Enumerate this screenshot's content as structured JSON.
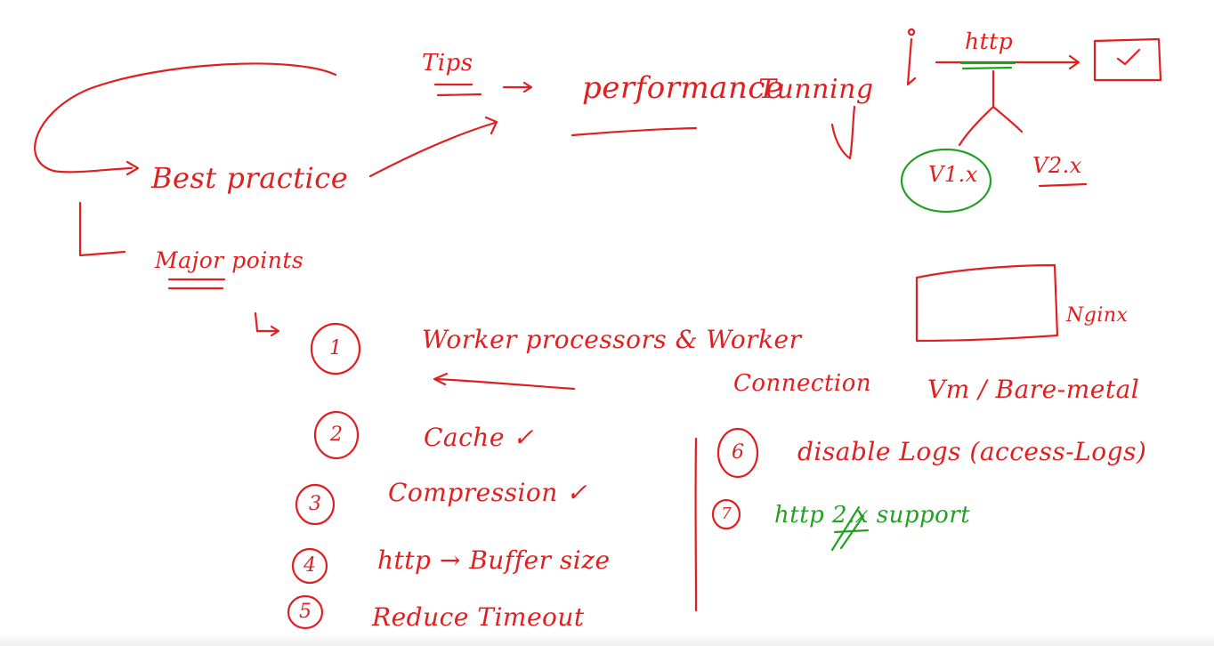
{
  "colors": {
    "red_ink": "#e02020",
    "green_ink": "#22a022",
    "background": "#ffffff"
  },
  "notes": {
    "tips": "Tips",
    "arrow_glyph": "→",
    "performance": "performance",
    "tunning": "Tunning",
    "best_practice": "Best practice",
    "major_points": "Major points",
    "http_top": "http",
    "v1": "V1.x",
    "v2": "V2.x",
    "nginx": "Nginx",
    "vm_baremetal": "Vm / Bare-metal"
  },
  "points": [
    {
      "num": "1",
      "text": "Worker processors & Worker",
      "text2": "Connection"
    },
    {
      "num": "2",
      "text": "Cache ✓"
    },
    {
      "num": "3",
      "text": "Compression ✓"
    },
    {
      "num": "4",
      "text": "http → Buffer size"
    },
    {
      "num": "5",
      "text": "Reduce Timeout"
    },
    {
      "num": "6",
      "text": "disable Logs (access-Logs)"
    },
    {
      "num": "7",
      "text": "http 2.x support"
    }
  ]
}
